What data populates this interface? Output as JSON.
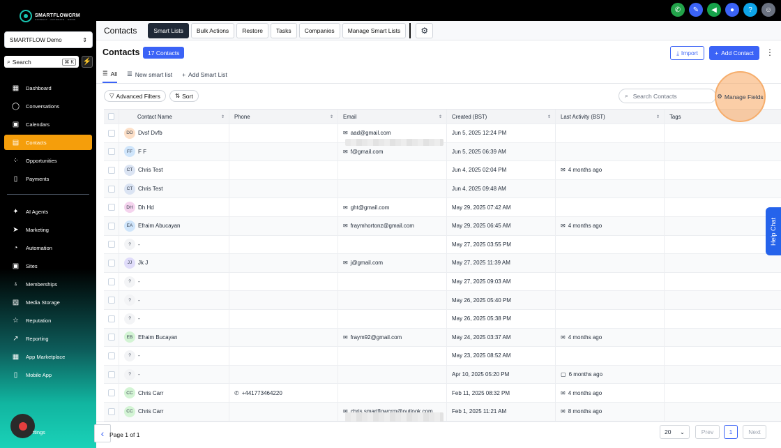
{
  "brand": {
    "name": "SMARTFLOWCRM",
    "tagline": "CONNECT · AUTOMATE · GROW"
  },
  "account": {
    "name": "SMARTFLOW Demo"
  },
  "sidebar_search": {
    "label": "Search",
    "shortcut": "⌘ K"
  },
  "nav": [
    {
      "label": "Dashboard",
      "icon": "dashboard-icon",
      "glyph": "▦"
    },
    {
      "label": "Conversations",
      "icon": "chat-icon",
      "glyph": "◯"
    },
    {
      "label": "Calendars",
      "icon": "calendar-icon",
      "glyph": "▣"
    },
    {
      "label": "Contacts",
      "icon": "contacts-icon",
      "glyph": "▤",
      "active": true
    },
    {
      "label": "Opportunities",
      "icon": "opportunities-icon",
      "glyph": "⁘"
    },
    {
      "label": "Payments",
      "icon": "payments-icon",
      "glyph": "▯"
    },
    {
      "label": "AI Agents",
      "icon": "ai-agents-icon",
      "glyph": "✦"
    },
    {
      "label": "Marketing",
      "icon": "marketing-icon",
      "glyph": "➤"
    },
    {
      "label": "Automation",
      "icon": "automation-icon",
      "glyph": "◔"
    },
    {
      "label": "Sites",
      "icon": "sites-icon",
      "glyph": "▣"
    },
    {
      "label": "Memberships",
      "icon": "memberships-icon",
      "glyph": "♁"
    },
    {
      "label": "Media Storage",
      "icon": "media-storage-icon",
      "glyph": "▨"
    },
    {
      "label": "Reputation",
      "icon": "reputation-icon",
      "glyph": "☆"
    },
    {
      "label": "Reporting",
      "icon": "reporting-icon",
      "glyph": "↗"
    },
    {
      "label": "App Marketplace",
      "icon": "marketplace-icon",
      "glyph": "▦"
    },
    {
      "label": "Mobile App",
      "icon": "mobile-icon",
      "glyph": "▯"
    }
  ],
  "settings_label": "ttings",
  "topbar_icons": [
    {
      "name": "phone-icon",
      "color": "#22a34a",
      "glyph": "✆"
    },
    {
      "name": "magic-icon",
      "color": "#3b63f6",
      "glyph": "✎"
    },
    {
      "name": "megaphone-icon",
      "color": "#16a34a",
      "glyph": "◀"
    },
    {
      "name": "bell-icon",
      "color": "#3b63f6",
      "glyph": "●"
    },
    {
      "name": "help-icon",
      "color": "#0ea5e9",
      "glyph": "?"
    },
    {
      "name": "avatar",
      "color": "#6b7280",
      "glyph": "☺"
    }
  ],
  "subnav": {
    "title": "Contacts",
    "tabs": [
      "Smart Lists",
      "Bulk Actions",
      "Restore",
      "Tasks",
      "Companies",
      "Manage Smart Lists"
    ]
  },
  "header": {
    "title": "Contacts",
    "count_badge": "17 Contacts",
    "import_label": "Import",
    "add_label": "Add Contact"
  },
  "views": {
    "all": "All",
    "new": "New smart list",
    "add": "Add Smart List"
  },
  "toolbar": {
    "filters": "Advanced Filters",
    "sort": "Sort",
    "search_placeholder": "Search Contacts",
    "manage_fields": "Manage Fields"
  },
  "columns": [
    "Contact Name",
    "Phone",
    "Email",
    "Created (BST)",
    "Last Activity (BST)",
    "Tags"
  ],
  "rows": [
    {
      "initials": "DD",
      "av": "#fde0c8",
      "name": "Dvsf Dvfb",
      "phone": "",
      "email": "aad@gmail.com",
      "created": "Jun 5, 2025 12:24 PM",
      "activity": "",
      "act_icon": ""
    },
    {
      "initials": "FF",
      "av": "#cfe5fb",
      "name": "F F",
      "phone": "",
      "email": "f@gmail.com",
      "created": "Jun 5, 2025 06:39 AM",
      "activity": "",
      "act_icon": ""
    },
    {
      "initials": "CT",
      "av": "#dbe4f3",
      "name": "Chris Test",
      "phone": "",
      "email": "",
      "created": "Jun 4, 2025 02:04 PM",
      "activity": "4 months ago",
      "act_icon": "mail"
    },
    {
      "initials": "CT",
      "av": "#dbe4f3",
      "name": "Chris Test",
      "phone": "",
      "email": "",
      "created": "Jun 4, 2025 09:48 AM",
      "activity": "",
      "act_icon": ""
    },
    {
      "initials": "DH",
      "av": "#f5d4ee",
      "name": "Dh Hd",
      "phone": "",
      "email": "ght@gmail.com",
      "created": "May 29, 2025 07:42 AM",
      "activity": "",
      "act_icon": ""
    },
    {
      "initials": "EA",
      "av": "#cfe5fb",
      "name": "Efraim Abucayan",
      "phone": "",
      "email": "fraymhortonz@gmail.com",
      "created": "May 29, 2025 06:45 AM",
      "activity": "4 months ago",
      "act_icon": "mail"
    },
    {
      "initials": "?",
      "av": "#f3f4f6",
      "name": "-",
      "phone": "",
      "email": "",
      "created": "May 27, 2025 03:55 PM",
      "activity": "",
      "act_icon": ""
    },
    {
      "initials": "JJ",
      "av": "#e0dcfa",
      "name": "Jk J",
      "phone": "",
      "email": "j@gmail.com",
      "created": "May 27, 2025 11:39 AM",
      "activity": "",
      "act_icon": ""
    },
    {
      "initials": "?",
      "av": "#f3f4f6",
      "name": "-",
      "phone": "",
      "email": "",
      "created": "May 27, 2025 09:03 AM",
      "activity": "",
      "act_icon": ""
    },
    {
      "initials": "?",
      "av": "#f3f4f6",
      "name": "-",
      "phone": "",
      "email": "",
      "created": "May 26, 2025 05:40 PM",
      "activity": "",
      "act_icon": ""
    },
    {
      "initials": "?",
      "av": "#f3f4f6",
      "name": "-",
      "phone": "",
      "email": "",
      "created": "May 26, 2025 05:38 PM",
      "activity": "",
      "act_icon": ""
    },
    {
      "initials": "EB",
      "av": "#d3f4d4",
      "name": "Efraim Bucayan",
      "phone": "",
      "email": "fraym92@gmail.com",
      "created": "May 24, 2025 03:37 AM",
      "activity": "4 months ago",
      "act_icon": "mail"
    },
    {
      "initials": "?",
      "av": "#f3f4f6",
      "name": "-",
      "phone": "",
      "email": "",
      "created": "May 23, 2025 08:52 AM",
      "activity": "",
      "act_icon": ""
    },
    {
      "initials": "?",
      "av": "#f3f4f6",
      "name": "-",
      "phone": "",
      "email": "",
      "created": "Apr 10, 2025 05:20 PM",
      "activity": "6 months ago",
      "act_icon": "chat"
    },
    {
      "initials": "CC",
      "av": "#d3f4d4",
      "name": "Chris Carr",
      "phone": "+441773464220",
      "email": "",
      "created": "Feb 11, 2025 08:32 PM",
      "activity": "4 months ago",
      "act_icon": "mail"
    },
    {
      "initials": "CC",
      "av": "#d3f4d4",
      "name": "Chris Carr",
      "phone": "",
      "email": "chris.smartflowcrm@outlook.com",
      "created": "Feb 1, 2025 11:21 AM",
      "activity": "8 months ago",
      "act_icon": "mail"
    }
  ],
  "pagination": {
    "page_text": "Page 1 of 1",
    "per_page": "20",
    "prev": "Prev",
    "page": "1",
    "next": "Next"
  },
  "help_chat": "Help Chat"
}
